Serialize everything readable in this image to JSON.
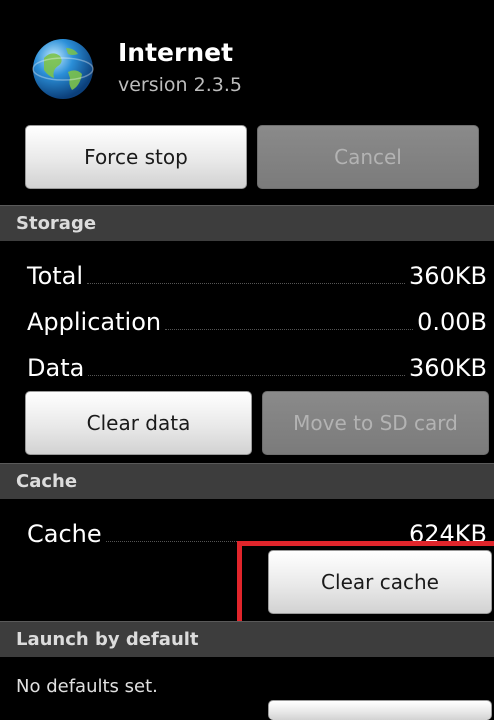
{
  "app": {
    "name": "Internet",
    "version": "version 2.3.5",
    "icon": "globe-icon"
  },
  "buttons": {
    "force_stop": "Force stop",
    "cancel": "Cancel",
    "clear_data": "Clear data",
    "move_to_sd": "Move to SD card",
    "clear_cache": "Clear cache"
  },
  "storage": {
    "header": "Storage",
    "rows": [
      {
        "label": "Total",
        "value": "360KB"
      },
      {
        "label": "Application",
        "value": "0.00B"
      },
      {
        "label": "Data",
        "value": "360KB"
      }
    ]
  },
  "cache": {
    "header": "Cache",
    "label": "Cache",
    "value": "624KB"
  },
  "launch": {
    "header": "Launch by default",
    "text": "No defaults set."
  },
  "colors": {
    "highlight": "#e0252b",
    "section_bar": "#3d3d3d"
  }
}
